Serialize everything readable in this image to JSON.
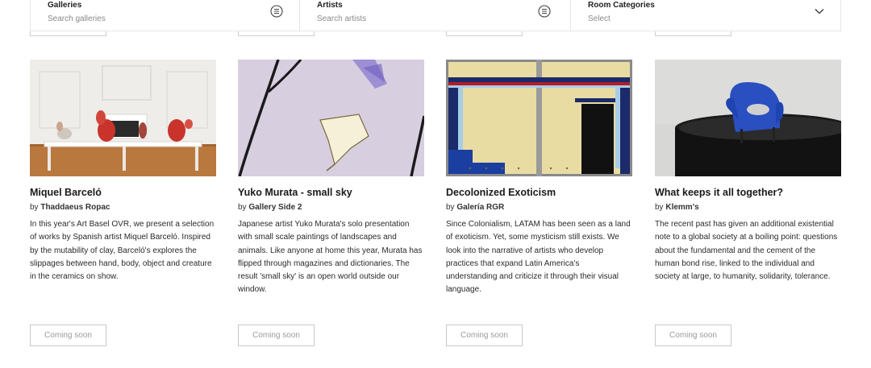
{
  "filters": [
    {
      "label": "Galleries",
      "placeholder": "Search galleries",
      "icon": "list-circle-icon"
    },
    {
      "label": "Artists",
      "placeholder": "Search artists",
      "icon": "list-circle-icon"
    },
    {
      "label": "Room Categories",
      "placeholder": "Select",
      "icon": "chevron-down-icon"
    }
  ],
  "cards": [
    {
      "title": "Miquel Barceló",
      "by": "by",
      "gallery": "Thaddaeus Ropac",
      "description": "In this year's Art Basel OVR, we present a selection of works by Spanish artist Miquel Barceló. Inspired by the mutability of clay, Barceló's explores the slippages between hand, body, object and creature in the ceramics on show.",
      "button": "Coming soon"
    },
    {
      "title": "Yuko Murata - small sky",
      "by": "by",
      "gallery": "Gallery Side 2",
      "description": "Japanese artist Yuko Murata's solo presentation with small scale paintings of landscapes and animals. Like anyone at home this year, Murata has flipped through magazines and dictionaries. The result 'small sky' is an open world outside our window.",
      "button": "Coming soon"
    },
    {
      "title": "Decolonized Exoticism",
      "by": "by",
      "gallery": "Galería RGR",
      "description": "Since Colonialism, LATAM has been seen as a land of exoticism. Yet, some mysticism still exists. We look into the narrative of artists who develop practices that expand Latin America's understanding and criticize it through their visual language.",
      "button": "Coming soon"
    },
    {
      "title": "What keeps it all together?",
      "by": "by",
      "gallery": "Klemm's",
      "description": "The recent past has given an additional existential note to a global society at a boiling point: questions about the fundamental and the cement of the human bond rise, linked to the individual and society at large, to humanity, solidarity, tolerance.",
      "button": "Coming soon"
    }
  ]
}
